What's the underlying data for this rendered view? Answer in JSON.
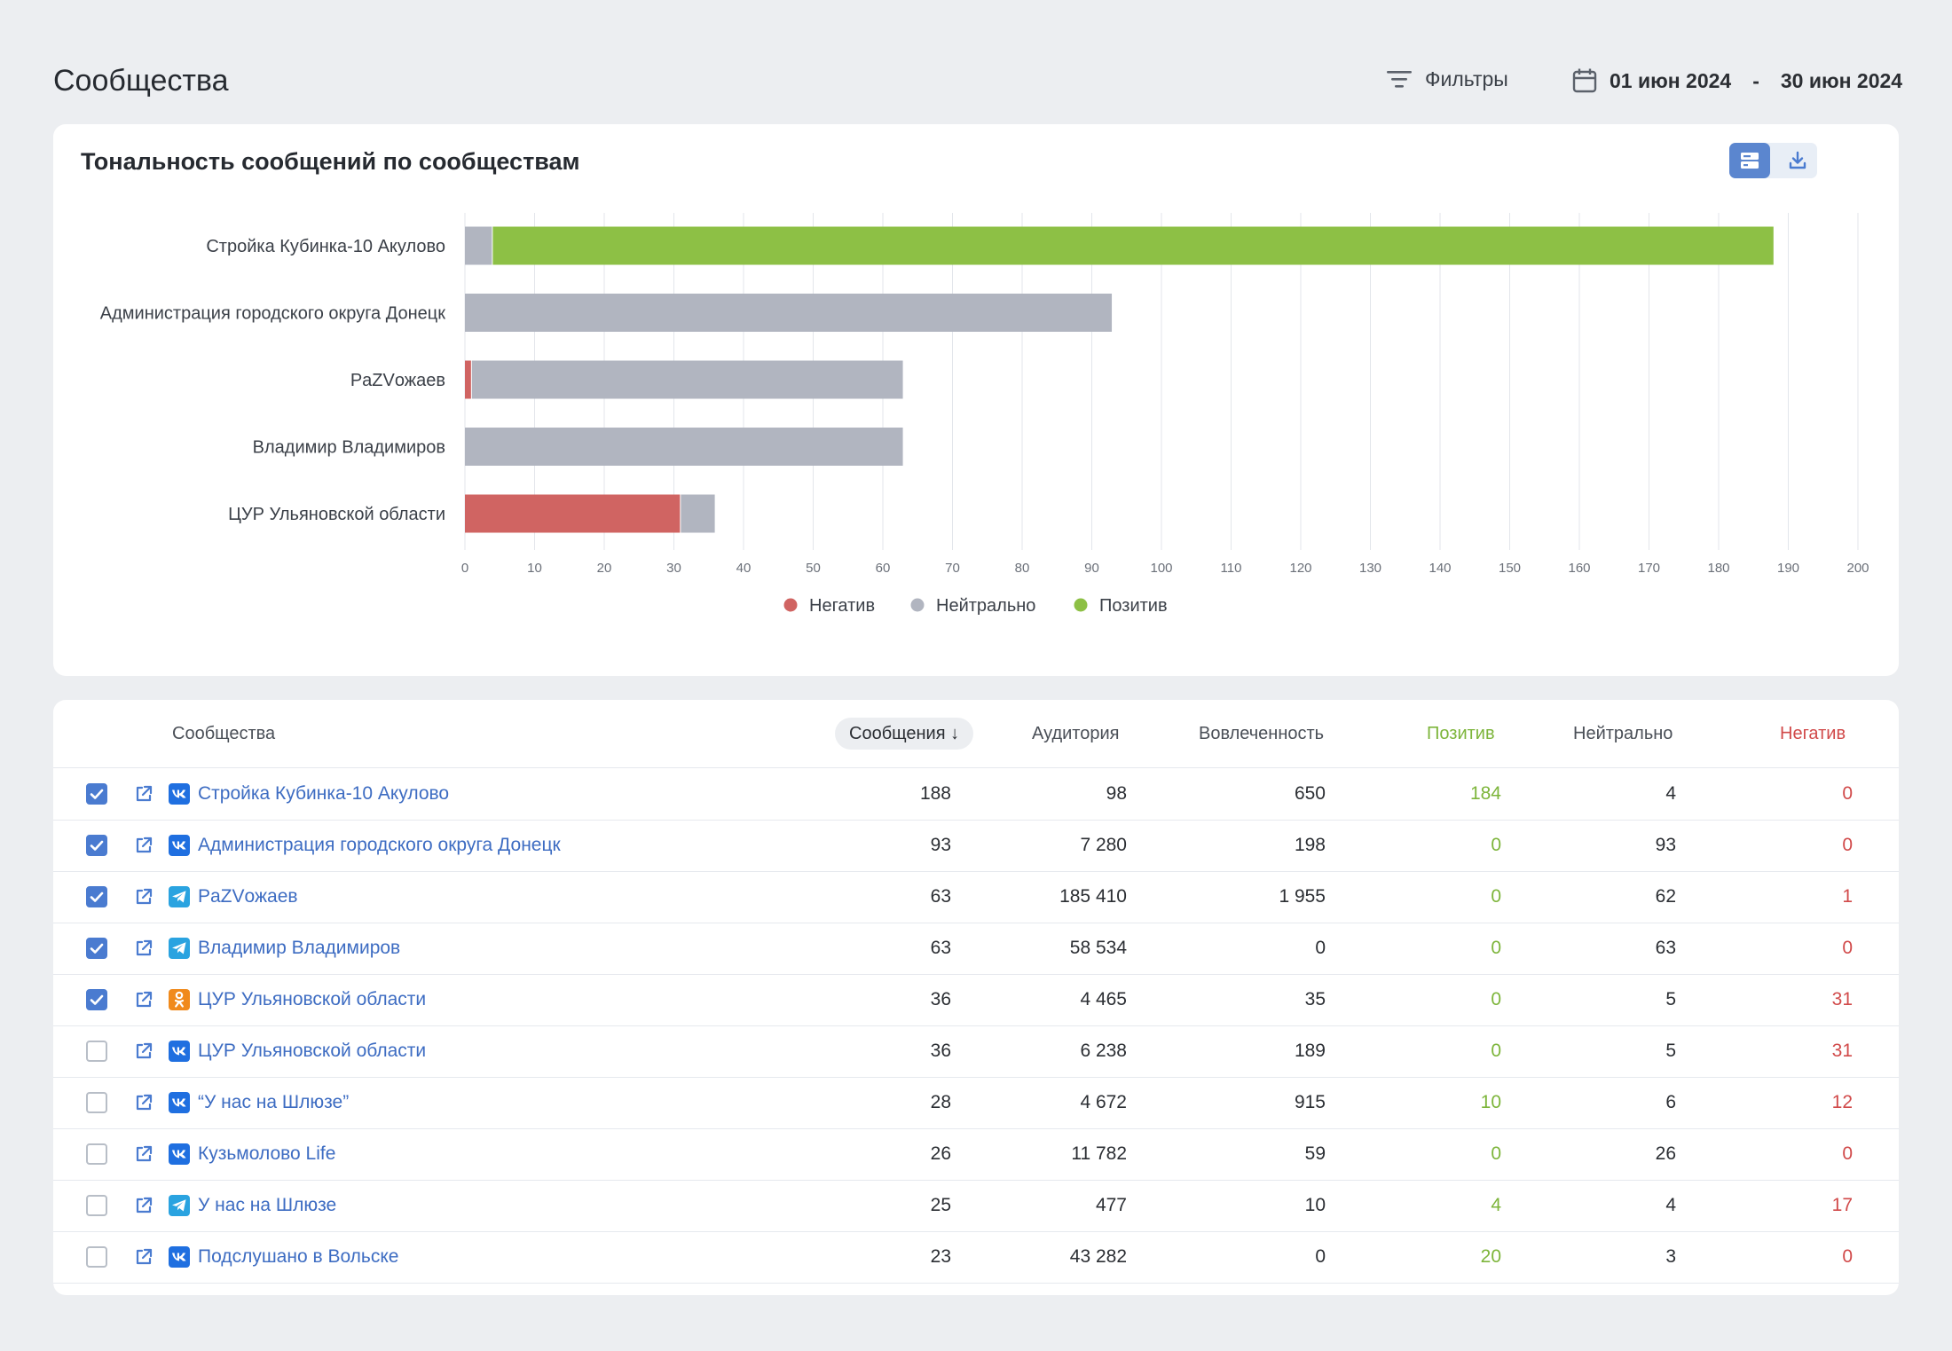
{
  "page": {
    "title": "Сообщества",
    "filters_label": "Фильтры",
    "date_from": "01 июн 2024",
    "date_sep": "-",
    "date_to": "30 июн 2024"
  },
  "chart_card": {
    "title": "Тональность сообщений по сообществам"
  },
  "chart_data": {
    "type": "bar",
    "orientation": "horizontal",
    "stacked": true,
    "categories": [
      "Стройка Кубинка-10 Акулово",
      "Администрация городского округа Донецк",
      "PaZVожаев",
      "Владимир Владимиров",
      "ЦУР Ульяновской области"
    ],
    "series": [
      {
        "name": "Негатив",
        "color": "#d06462",
        "values": [
          0,
          0,
          1,
          0,
          31
        ]
      },
      {
        "name": "Нейтрально",
        "color": "#b1b5c0",
        "values": [
          4,
          93,
          62,
          63,
          5
        ]
      },
      {
        "name": "Позитив",
        "color": "#8dc045",
        "values": [
          184,
          0,
          0,
          0,
          0
        ]
      }
    ],
    "xlim": [
      0,
      200
    ],
    "xticks": [
      "0",
      "10",
      "20",
      "30",
      "40",
      "50",
      "60",
      "70",
      "80",
      "90",
      "100",
      "110",
      "120",
      "130",
      "140",
      "150",
      "160",
      "170",
      "180",
      "190",
      "200"
    ],
    "grid": true,
    "legend_position": "bottom"
  },
  "table": {
    "headers": {
      "community": "Сообщества",
      "messages": "Сообщения ↓",
      "audience": "Аудитория",
      "engagement": "Вовлеченность",
      "positive": "Позитив",
      "neutral": "Нейтрально",
      "negative": "Негатив"
    },
    "rows": [
      {
        "checked": true,
        "network": "vk",
        "name": "Стройка Кубинка-10 Акулово",
        "messages": "188",
        "audience": "98",
        "engagement": "650",
        "positive": "184",
        "neutral": "4",
        "negative": "0"
      },
      {
        "checked": true,
        "network": "vk",
        "name": "Администрация городского округа Донецк",
        "messages": "93",
        "audience": "7 280",
        "engagement": "198",
        "positive": "0",
        "neutral": "93",
        "negative": "0"
      },
      {
        "checked": true,
        "network": "tg",
        "name": "PaZVожаев",
        "messages": "63",
        "audience": "185 410",
        "engagement": "1 955",
        "positive": "0",
        "neutral": "62",
        "negative": "1"
      },
      {
        "checked": true,
        "network": "tg",
        "name": "Владимир Владимиров",
        "messages": "63",
        "audience": "58 534",
        "engagement": "0",
        "positive": "0",
        "neutral": "63",
        "negative": "0"
      },
      {
        "checked": true,
        "network": "ok",
        "name": "ЦУР Ульяновской области",
        "messages": "36",
        "audience": "4 465",
        "engagement": "35",
        "positive": "0",
        "neutral": "5",
        "negative": "31"
      },
      {
        "checked": false,
        "network": "vk",
        "name": "ЦУР Ульяновской области",
        "messages": "36",
        "audience": "6 238",
        "engagement": "189",
        "positive": "0",
        "neutral": "5",
        "negative": "31"
      },
      {
        "checked": false,
        "network": "vk",
        "name": "“У нас на Шлюзе”",
        "messages": "28",
        "audience": "4 672",
        "engagement": "915",
        "positive": "10",
        "neutral": "6",
        "negative": "12"
      },
      {
        "checked": false,
        "network": "vk",
        "name": "Кузьмолово Life",
        "messages": "26",
        "audience": "11 782",
        "engagement": "59",
        "positive": "0",
        "neutral": "26",
        "negative": "0"
      },
      {
        "checked": false,
        "network": "tg",
        "name": "У нас на Шлюзе",
        "messages": "25",
        "audience": "477",
        "engagement": "10",
        "positive": "4",
        "neutral": "4",
        "negative": "17"
      },
      {
        "checked": false,
        "network": "vk",
        "name": "Подслушано в Вольске",
        "messages": "23",
        "audience": "43 282",
        "engagement": "0",
        "positive": "20",
        "neutral": "3",
        "negative": "0"
      }
    ]
  },
  "colors": {
    "accent": "#4a7bd0",
    "link": "#3d6cc2",
    "positive": "#7db53b",
    "negative": "#d14a4a",
    "vk": "#1f6fe0",
    "tg": "#2aa3e0",
    "ok": "#f08a1c"
  },
  "icons": {
    "filters": "filter-lines-icon",
    "date": "calendar-icon",
    "view_bars": "bar-view-icon",
    "view_list": "list-view-icon",
    "download": "download-icon",
    "external": "external-link-icon"
  }
}
